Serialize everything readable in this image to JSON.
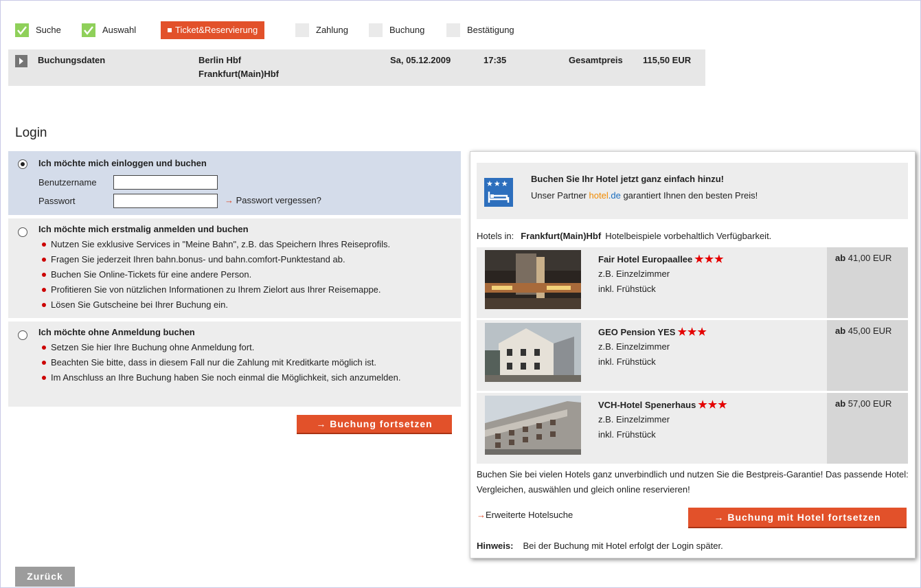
{
  "steps": [
    {
      "label": "Suche",
      "state": "done"
    },
    {
      "label": "Auswahl",
      "state": "done"
    },
    {
      "label": "Ticket&Reservierung",
      "state": "active"
    },
    {
      "label": "Zahlung",
      "state": "todo"
    },
    {
      "label": "Buchung",
      "state": "todo"
    },
    {
      "label": "Bestätigung",
      "state": "todo"
    }
  ],
  "booking": {
    "label": "Buchungsdaten",
    "from": "Berlin Hbf",
    "to": "Frankfurt(Main)Hbf",
    "date": "Sa, 05.12.2009",
    "time": "17:35",
    "total_label": "Gesamtpreis",
    "total_value": "115,50 EUR"
  },
  "login": {
    "title": "Login",
    "option1": {
      "title": "Ich möchte mich einloggen und buchen",
      "username_label": "Benutzername",
      "password_label": "Passwort",
      "forgot_arrow": "→",
      "forgot_label": "Passwort vergessen?"
    },
    "option2": {
      "title": "Ich möchte mich erstmalig anmelden und buchen",
      "bullets": [
        "Nutzen Sie exklusive Services in \"Meine Bahn\", z.B. das Speichern Ihres Reiseprofils.",
        "Fragen Sie jederzeit Ihren bahn.bonus- und bahn.comfort-Punktestand ab.",
        "Buchen Sie Online-Tickets für eine andere Person.",
        "Profitieren Sie von nützlichen Informationen zu Ihrem Zielort aus Ihrer Reisemappe.",
        "Lösen Sie Gutscheine bei Ihrer Buchung ein."
      ]
    },
    "option3": {
      "title": "Ich möchte ohne Anmeldung buchen",
      "bullets": [
        "Setzen Sie hier Ihre Buchung ohne Anmeldung fort.",
        "Beachten Sie bitte, dass in diesem Fall nur die Zahlung mit Kreditkarte möglich ist.",
        "Im Anschluss an Ihre Buchung haben Sie noch einmal die Möglichkeit, sich anzumelden."
      ]
    },
    "continue_button": "→ Buchung fortsetzen"
  },
  "hotel": {
    "icon_stars": "★★★",
    "head_title": "Buchen Sie Ihr Hotel jetzt ganz einfach hinzu!",
    "head_sub_pre": "Unser Partner ",
    "head_sub_partner_a": "hotel",
    "head_sub_partner_b": ".de",
    "head_sub_post": " garantiert Ihnen den besten Preis!",
    "hotels_in_label": "Hotels in:",
    "hotels_in_city": "Frankfurt(Main)Hbf",
    "hotels_in_note": "Hotelbeispiele vorbehaltlich Verfügbarkeit.",
    "items": [
      {
        "name": "Fair Hotel Europaallee",
        "stars": "★★★",
        "room": "z.B. Einzelzimmer",
        "breakfast": "inkl. Frühstück",
        "price_prefix": "ab",
        "price": "41,00 EUR"
      },
      {
        "name": "GEO Pension YES",
        "stars": "★★★",
        "room": "z.B. Einzelzimmer",
        "breakfast": "inkl. Frühstück",
        "price_prefix": "ab",
        "price": "45,00 EUR"
      },
      {
        "name": "VCH-Hotel Spenerhaus",
        "stars": "★★★",
        "room": "z.B. Einzelzimmer",
        "breakfast": "inkl. Frühstück",
        "price_prefix": "ab",
        "price": "57,00 EUR"
      }
    ],
    "text": "Buchen Sie bei vielen Hotels ganz unverbindlich und nutzen Sie die Bestpreis-Garantie! Das passende Hotel: Vergleichen, auswählen und gleich online reservieren!",
    "ext_arrow": "→",
    "ext_search": "Erweiterte Hotelsuche",
    "hotel_button": "→ Buchung mit Hotel fortsetzen",
    "hint_label": "Hinweis:",
    "hint_text": "Bei der Buchung mit Hotel erfolgt der Login später."
  },
  "back_button": "Zurück",
  "colors": {
    "accent": "#e2512a",
    "check": "#8fd05a",
    "login_bg": "#d4dcea",
    "panel_bg": "#ededed",
    "hotel_icon": "#2d6fbd"
  }
}
